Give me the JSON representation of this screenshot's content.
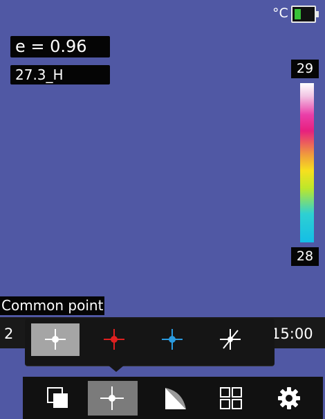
{
  "status": {
    "temperature_unit": "°C",
    "battery_icon": "battery-icon",
    "left_label": "Common point",
    "status_number": "2",
    "time_fragment": ":15:00"
  },
  "readouts": {
    "emissivity": "e  =  0.96",
    "point_temperature": "27.3_H"
  },
  "color_scale": {
    "max": "29",
    "min": "28"
  },
  "colors": {
    "background": "#5058a4",
    "selected_tool": "#a5a5a5",
    "accent_red": "#e02020",
    "accent_blue": "#2a9be0"
  },
  "submenu": {
    "items": [
      {
        "icon": "crosshair-white-icon",
        "selected": true
      },
      {
        "icon": "crosshair-red-icon",
        "selected": false
      },
      {
        "icon": "crosshair-blue-icon",
        "selected": false
      },
      {
        "icon": "crosshair-off-icon",
        "selected": false
      }
    ]
  },
  "menu": {
    "items": [
      {
        "icon": "copy-icon",
        "selected": false
      },
      {
        "icon": "crosshair-icon",
        "selected": true
      },
      {
        "icon": "measure-area-icon",
        "selected": false
      },
      {
        "icon": "grid-icon",
        "selected": false
      },
      {
        "icon": "gear-icon",
        "selected": false
      }
    ]
  }
}
